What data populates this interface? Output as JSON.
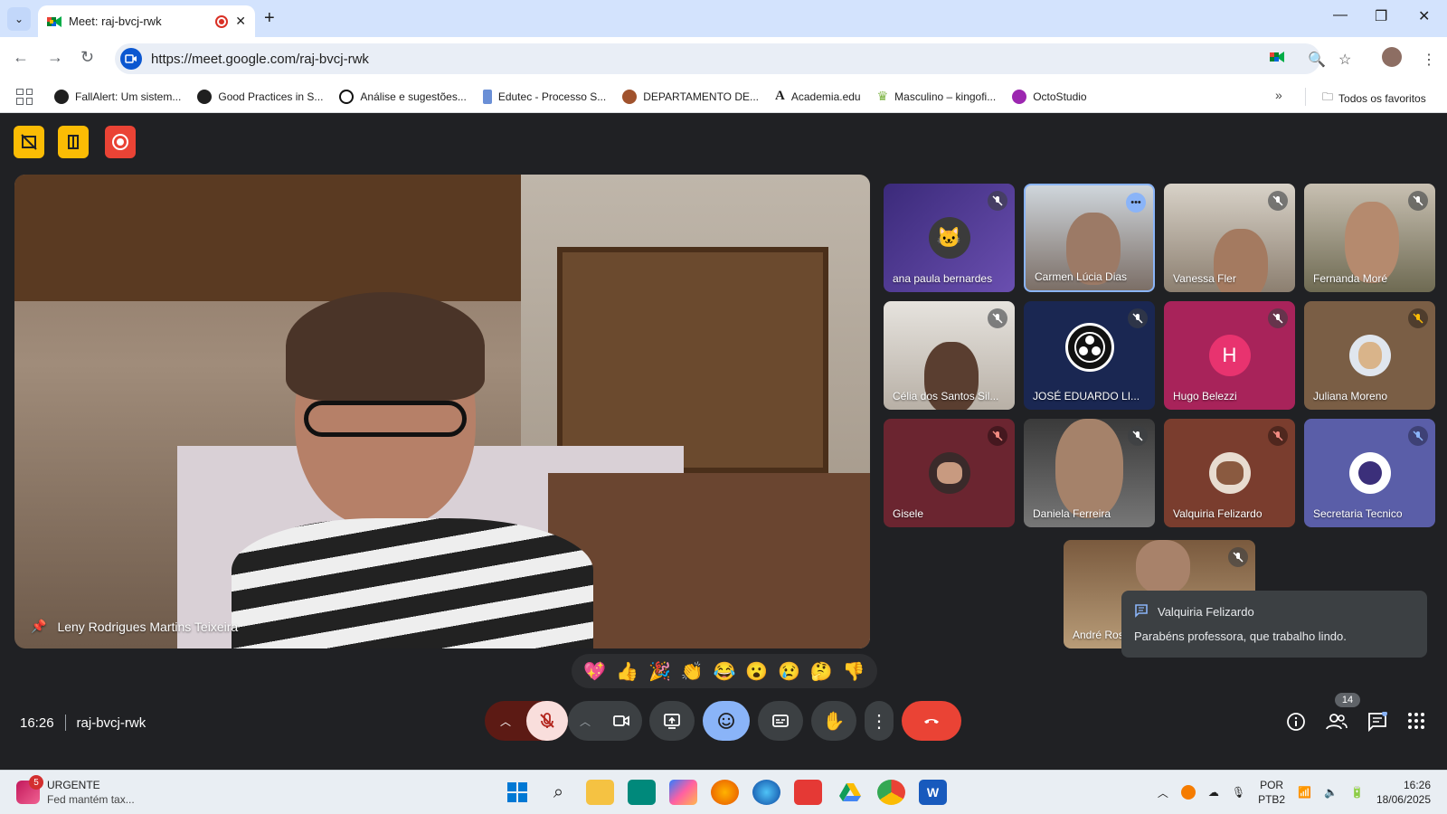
{
  "browser": {
    "tab_title": "Meet: raj-bvcj-rwk",
    "url": "https://meet.google.com/raj-bvcj-rwk"
  },
  "bookmarks": [
    {
      "label": "FallAlert: Um sistem...",
      "icon": "fallalert-icon"
    },
    {
      "label": "Good Practices in S...",
      "icon": "gp-icon"
    },
    {
      "label": "Análise e sugestões...",
      "icon": "openai-icon"
    },
    {
      "label": "Edutec - Processo S...",
      "icon": "edutec-icon"
    },
    {
      "label": "DEPARTAMENTO DE...",
      "icon": "dept-icon"
    },
    {
      "label": "Academia.edu",
      "icon": "academia-icon"
    },
    {
      "label": "Masculino – kingofi...",
      "icon": "kingofi-icon"
    },
    {
      "label": "OctoStudio",
      "icon": "octostudio-icon"
    }
  ],
  "bookmarks_all": "Todos os favoritos",
  "meet": {
    "main_speaker": "Leny Rodrigues Martins Teixeira",
    "meeting_code": "raj-bvcj-rwk",
    "time": "16:26",
    "participants_count": "14",
    "tiles": [
      {
        "name": "ana paula bernardes"
      },
      {
        "name": "Carmen Lúcia Dias"
      },
      {
        "name": "Vanessa Fler"
      },
      {
        "name": "Fernanda Moré"
      },
      {
        "name": "Célia dos Santos Sil..."
      },
      {
        "name": "JOSÉ EDUARDO LI..."
      },
      {
        "name": "Hugo Belezzi",
        "initial": "H"
      },
      {
        "name": "Juliana Moreno"
      },
      {
        "name": "Gisele"
      },
      {
        "name": "Daniela Ferreira"
      },
      {
        "name": "Valquiria Felizardo"
      },
      {
        "name": "Secretaria Tecnico"
      },
      {
        "name": "André Ros"
      }
    ],
    "toast": {
      "sender": "Valquiria Felizardo",
      "message": "Parabéns professora, que trabalho lindo."
    },
    "reactions": [
      "💖",
      "👍",
      "🎉",
      "👏",
      "😂",
      "😮",
      "😢",
      "🤔",
      "👎"
    ]
  },
  "taskbar": {
    "news_badge": "5",
    "news_title": "URGENTE",
    "news_sub": "Fed mantém tax...",
    "lang1": "POR",
    "lang2": "PTB2",
    "time": "16:26",
    "date": "18/06/2025"
  },
  "colors": {
    "meet_bg": "#202124",
    "end_call": "#ea4335",
    "accent_blue": "#8ab4f8",
    "host_yellow": "#fbbc04",
    "record_red": "#ea4335"
  }
}
